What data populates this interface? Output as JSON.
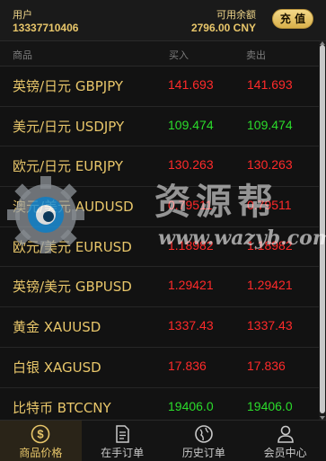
{
  "header": {
    "user_label": "用户",
    "user_phone": "13337710406",
    "balance_label": "可用余额",
    "balance_value": "2796.00 CNY",
    "recharge_label": "充 值"
  },
  "columns": {
    "name": "商品",
    "buy": "买入",
    "sell": "卖出"
  },
  "rows": [
    {
      "name": "英镑/日元 GBPJPY",
      "buy": "141.693",
      "sell": "141.693",
      "trend": "up"
    },
    {
      "name": "美元/日元 USDJPY",
      "buy": "109.474",
      "sell": "109.474",
      "trend": "down"
    },
    {
      "name": "欧元/日元 EURJPY",
      "buy": "130.263",
      "sell": "130.263",
      "trend": "up"
    },
    {
      "name": "澳元/美元 AUDUSD",
      "buy": "0.79511",
      "sell": "0.79511",
      "trend": "up"
    },
    {
      "name": "欧元/美元 EURUSD",
      "buy": "1.18982",
      "sell": "1.18982",
      "trend": "up"
    },
    {
      "name": "英镑/美元 GBPUSD",
      "buy": "1.29421",
      "sell": "1.29421",
      "trend": "up"
    },
    {
      "name": "黄金 XAUUSD",
      "buy": "1337.43",
      "sell": "1337.43",
      "trend": "up"
    },
    {
      "name": "白银 XAGUSD",
      "buy": "17.836",
      "sell": "17.836",
      "trend": "up"
    },
    {
      "name": "比特币 BTCCNY",
      "buy": "19406.0",
      "sell": "19406.0",
      "trend": "down"
    }
  ],
  "tabs": [
    {
      "label": "商品价格",
      "icon": "dollar-coin-icon",
      "active": true
    },
    {
      "label": "在手订单",
      "icon": "document-icon",
      "active": false
    },
    {
      "label": "历史订单",
      "icon": "globe-history-icon",
      "active": false
    },
    {
      "label": "会员中心",
      "icon": "user-icon",
      "active": false
    }
  ],
  "watermark": {
    "text": "资源帮",
    "url": "www.wazyb.com"
  },
  "colors": {
    "accent": "#e8c66a",
    "price_up": "#ff2a2a",
    "price_down": "#2bdc2b",
    "background": "#0f0f0f"
  }
}
